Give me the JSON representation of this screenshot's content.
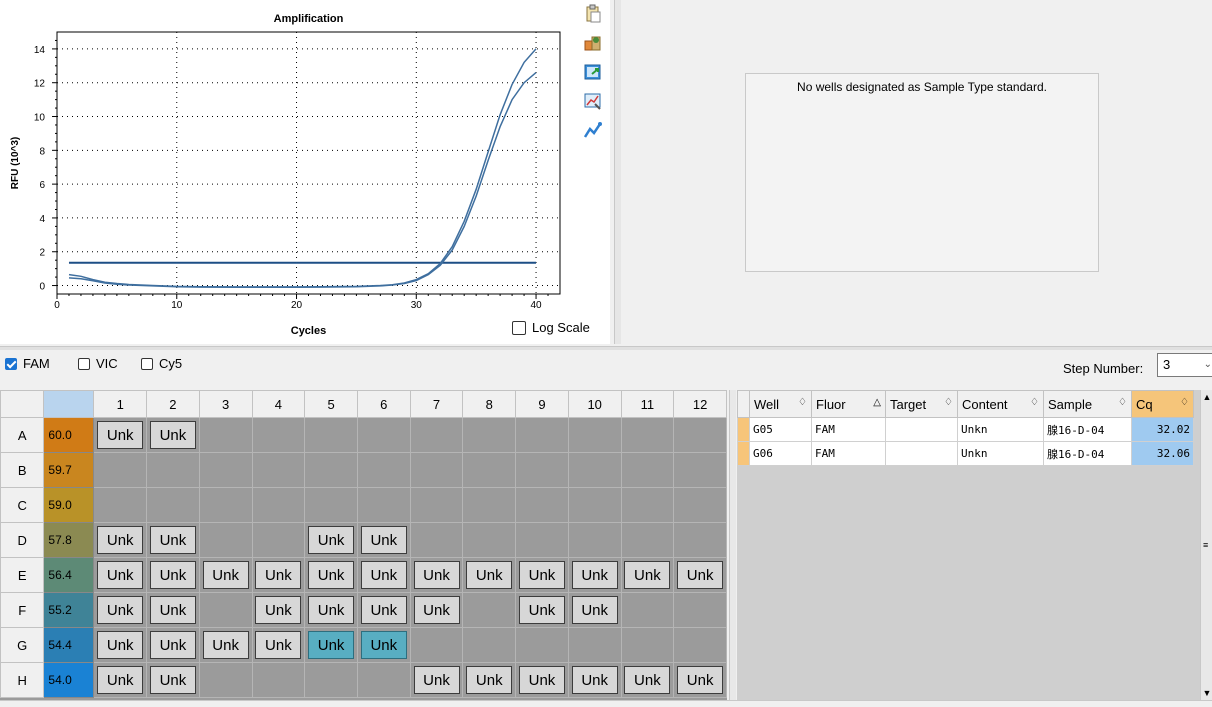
{
  "chart_data": {
    "type": "line",
    "title": "Amplification",
    "xlabel": "Cycles",
    "ylabel": "RFU (10^3)",
    "xlim": [
      0,
      42
    ],
    "ylim": [
      -0.5,
      15
    ],
    "xticks": [
      "0",
      "10",
      "20",
      "30",
      "40"
    ],
    "yticks": [
      "0",
      "2",
      "4",
      "6",
      "8",
      "10",
      "12",
      "14"
    ],
    "grid": true,
    "threshold": 1.35,
    "series": [
      {
        "x": [
          1,
          2,
          3,
          4,
          5,
          6,
          8,
          10,
          12,
          15,
          18,
          20,
          22,
          25,
          27,
          28,
          29,
          30,
          31,
          32,
          33,
          34,
          35,
          36,
          37,
          38,
          39,
          40
        ],
        "y": [
          0.65,
          0.55,
          0.35,
          0.2,
          0.12,
          0.06,
          0.0,
          -0.05,
          -0.07,
          -0.08,
          -0.08,
          -0.08,
          -0.07,
          -0.05,
          0.0,
          0.05,
          0.15,
          0.35,
          0.7,
          1.3,
          2.3,
          3.8,
          5.7,
          7.9,
          10.1,
          11.9,
          13.2,
          14.0
        ]
      },
      {
        "x": [
          1,
          2,
          3,
          4,
          5,
          6,
          8,
          10,
          12,
          15,
          18,
          20,
          22,
          25,
          27,
          28,
          29,
          30,
          31,
          32,
          33,
          34,
          35,
          36,
          37,
          38,
          39,
          40
        ],
        "y": [
          0.45,
          0.4,
          0.28,
          0.15,
          0.08,
          0.03,
          -0.02,
          -0.07,
          -0.09,
          -0.1,
          -0.1,
          -0.1,
          -0.09,
          -0.07,
          -0.02,
          0.03,
          0.12,
          0.3,
          0.65,
          1.2,
          2.1,
          3.5,
          5.3,
          7.4,
          9.4,
          11.0,
          12.0,
          12.6
        ]
      }
    ],
    "log_scale_label": "Log Scale",
    "log_scale_checked": false,
    "colors": {
      "curve": "#3f6f9f",
      "threshold": "#1d4f85"
    }
  },
  "toolbar_icons": [
    "clipboard-icon",
    "export-tools-icon",
    "export-image-icon",
    "chart-settings-icon",
    "trend-line-icon"
  ],
  "standard_curve": {
    "message": "No wells designated as Sample Type standard."
  },
  "fluorophores": [
    {
      "label": "FAM",
      "checked": true
    },
    {
      "label": "VIC",
      "checked": false
    },
    {
      "label": "Cy5",
      "checked": false
    }
  ],
  "step": {
    "label": "Step Number:",
    "value": "3"
  },
  "plate": {
    "columns": [
      "1",
      "2",
      "3",
      "4",
      "5",
      "6",
      "7",
      "8",
      "9",
      "10",
      "11",
      "12"
    ],
    "rows": [
      {
        "row": "A",
        "temp": "60.0",
        "color": "#d07b16",
        "wells": [
          "Unk",
          "Unk",
          "",
          "",
          "",
          "",
          "",
          "",
          "",
          "",
          "",
          ""
        ],
        "selected": []
      },
      {
        "row": "B",
        "temp": "59.7",
        "color": "#c9861f",
        "wells": [
          "",
          "",
          "",
          "",
          "",
          "",
          "",
          "",
          "",
          "",
          "",
          ""
        ],
        "selected": []
      },
      {
        "row": "C",
        "temp": "59.0",
        "color": "#b99228",
        "wells": [
          "",
          "",
          "",
          "",
          "",
          "",
          "",
          "",
          "",
          "",
          "",
          ""
        ],
        "selected": []
      },
      {
        "row": "D",
        "temp": "57.8",
        "color": "#8b8a52",
        "wells": [
          "Unk",
          "Unk",
          "",
          "",
          "Unk",
          "Unk",
          "",
          "",
          "",
          "",
          "",
          ""
        ],
        "selected": []
      },
      {
        "row": "E",
        "temp": "56.4",
        "color": "#5d8a76",
        "wells": [
          "Unk",
          "Unk",
          "Unk",
          "Unk",
          "Unk",
          "Unk",
          "Unk",
          "Unk",
          "Unk",
          "Unk",
          "Unk",
          "Unk"
        ],
        "selected": []
      },
      {
        "row": "F",
        "temp": "55.2",
        "color": "#3f8397",
        "wells": [
          "Unk",
          "Unk",
          "",
          "Unk",
          "Unk",
          "Unk",
          "Unk",
          "",
          "Unk",
          "Unk",
          "",
          ""
        ],
        "selected": []
      },
      {
        "row": "G",
        "temp": "54.4",
        "color": "#2b7fb4",
        "wells": [
          "Unk",
          "Unk",
          "Unk",
          "Unk",
          "Unk",
          "Unk",
          "",
          "",
          "",
          "",
          "",
          ""
        ],
        "selected": [
          4,
          5
        ]
      },
      {
        "row": "H",
        "temp": "54.0",
        "color": "#1a82d4",
        "wells": [
          "Unk",
          "Unk",
          "",
          "",
          "",
          "",
          "Unk",
          "Unk",
          "Unk",
          "Unk",
          "Unk",
          "Unk"
        ],
        "selected": []
      }
    ]
  },
  "results": {
    "headers": [
      "Well",
      "Fluor",
      "Target",
      "Content",
      "Sample",
      "Cq"
    ],
    "rows": [
      {
        "well": "G05",
        "fluor": "FAM",
        "target": "",
        "content": "Unkn",
        "sample": "腺16-D-04",
        "cq": "32.02"
      },
      {
        "well": "G06",
        "fluor": "FAM",
        "target": "",
        "content": "Unkn",
        "sample": "腺16-D-04",
        "cq": "32.06"
      }
    ]
  }
}
